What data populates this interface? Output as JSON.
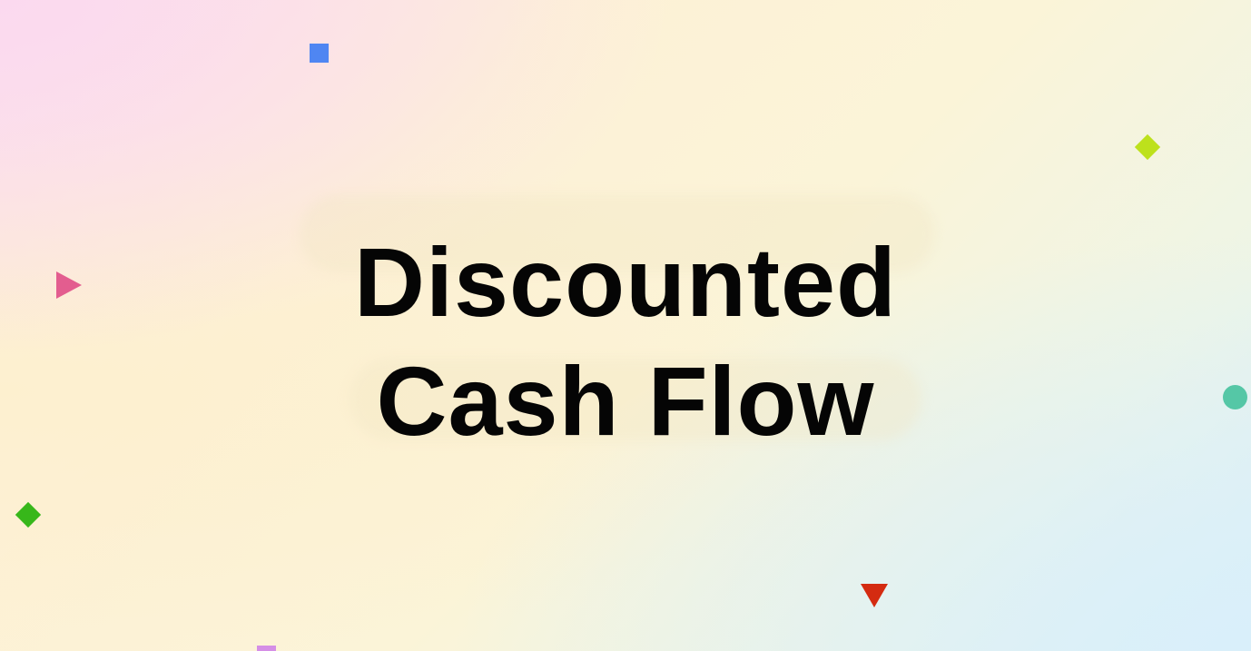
{
  "slide": {
    "title_line1": "Discounted",
    "title_line2": "Cash Flow"
  },
  "decorations": [
    {
      "shape": "square",
      "color": "#4f86f2"
    },
    {
      "shape": "diamond",
      "color": "#bde11c"
    },
    {
      "shape": "triangle-right",
      "color": "#e35d8f"
    },
    {
      "shape": "circle",
      "color": "#55c7a6"
    },
    {
      "shape": "diamond",
      "color": "#37b71a"
    },
    {
      "shape": "triangle-down",
      "color": "#d42b10"
    },
    {
      "shape": "square",
      "color": "#d58ee6"
    }
  ]
}
